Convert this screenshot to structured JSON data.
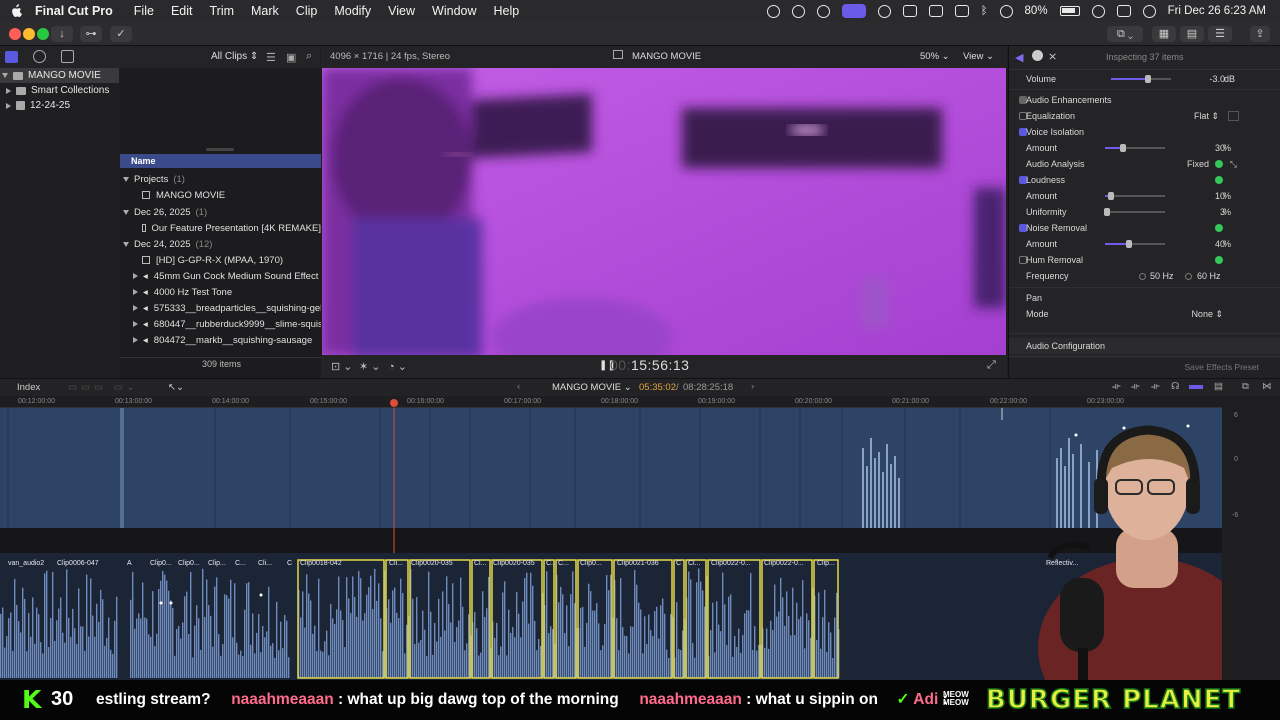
{
  "menubar": {
    "app_name": "Final Cut Pro",
    "items": [
      "File",
      "Edit",
      "Trim",
      "Mark",
      "Clip",
      "Modify",
      "View",
      "Window",
      "Help"
    ],
    "battery": "80%",
    "clock": "Fri Dec 26  6:23 AM"
  },
  "library_toolbar": {
    "filter": "All Clips"
  },
  "sidebar": {
    "items": [
      {
        "label": "MANGO MOVIE"
      },
      {
        "label": "Smart Collections"
      },
      {
        "label": "12-24-25"
      }
    ]
  },
  "browser": {
    "column_header": "Name",
    "groups": [
      {
        "label": "Projects",
        "count": "(1)"
      },
      {
        "label": "Dec 26, 2025",
        "count": "(1)"
      },
      {
        "label": "Dec 24, 2025",
        "count": "(12)"
      }
    ],
    "rows": [
      "MANGO MOVIE",
      "Our Feature Presentation [4K REMAKE]",
      "[HD] G-GP-R-X (MPAA, 1970)",
      "45mm Gun Cock Medium Sound Effect",
      "4000 Hz Test Tone",
      "575333__breadparticles__squishing-gel",
      "680447__rubberduck9999__slime-squis",
      "804472__markb__squishing-sausage"
    ],
    "item_count": "309 items"
  },
  "viewer": {
    "format": "4096 × 1716 | 24 fps, Stereo",
    "title": "MANGO MOVIE",
    "zoom": "50%",
    "view_menu": "View",
    "timecode_dim": "00:",
    "timecode": "15:56:13"
  },
  "inspector": {
    "title": "Inspecting 37 items",
    "volume_label": "Volume",
    "volume_value": "-3.0",
    "volume_unit": "dB",
    "enhancements_label": "Audio Enhancements",
    "equalization_label": "Equalization",
    "equalization_value": "Flat",
    "voice_isolation_label": "Voice Isolation",
    "amount_label": "Amount",
    "voice_isolation_amount": "30",
    "percent_unit": "%",
    "audio_analysis_label": "Audio Analysis",
    "audio_analysis_value": "Fixed",
    "loudness_label": "Loudness",
    "loudness_amount": "10",
    "uniformity_label": "Uniformity",
    "uniformity_value": "3",
    "noise_removal_label": "Noise Removal",
    "noise_removal_amount": "40",
    "hum_removal_label": "Hum Removal",
    "frequency_label": "Frequency",
    "freq_50": "50",
    "freq_60": "60",
    "hz_unit": "Hz",
    "pan_label": "Pan",
    "mode_label": "Mode",
    "mode_value": "None",
    "audio_config_label": "Audio Configuration",
    "save_preset_label": "Save Effects Preset",
    "sliders": {
      "volume": 0.62,
      "voice_isolation": 0.3,
      "loudness": 0.1,
      "uniformity": 0.03,
      "noise_removal": 0.4
    }
  },
  "timeline": {
    "index_label": "Index",
    "project_name": "MANGO MOVIE",
    "position": "05:35:02",
    "duration": "08:28:25:18",
    "ruler_ticks": [
      "00:12:00:00",
      "00:13:00:00",
      "00:14:00:00",
      "00:15:00:00",
      "00:16:00:00",
      "00:17:00:00",
      "00:18:00:00",
      "00:19:00:00",
      "00:20:00:00",
      "00:21:00:00",
      "00:22:00:00",
      "00:23:00:00"
    ],
    "clip_labels": [
      "van_audio2",
      "Clip0006-047",
      "A",
      "Clip0...",
      "Clip0...",
      "Clip...",
      "C...",
      "Cli...",
      "C",
      "Clip0018-042",
      "Cli...",
      "Clip0020-035",
      "Cl...",
      "Clip0020-035",
      "C...",
      "C...",
      "Clip0...",
      "Clip0021-036",
      "C",
      "Cl...",
      "Clip0022-0...",
      "Clip0022-0...",
      "Clip...",
      "Reflectiv..."
    ],
    "meter_labels": [
      "6",
      "0",
      "-6"
    ]
  },
  "overlay": {
    "k_count": "30",
    "ticker": [
      {
        "text": "estling stream?"
      },
      {
        "user": "naaahmeaaan",
        "text": " : what up big dawg top of the morning"
      },
      {
        "user": "naaahmeaaan",
        "text": " : what u sippin on"
      },
      {
        "user": "Adi",
        "text": " :"
      }
    ],
    "meow": "MEOW\nMEOW",
    "brand": "BURGER PLANET"
  },
  "colors": {
    "accent": "#5a5ae0",
    "viewer_magenta": "#b44bd9",
    "chat_user": "#ff6b8a",
    "brand_yellow": "#e8f040",
    "k_green": "#53fc18"
  }
}
